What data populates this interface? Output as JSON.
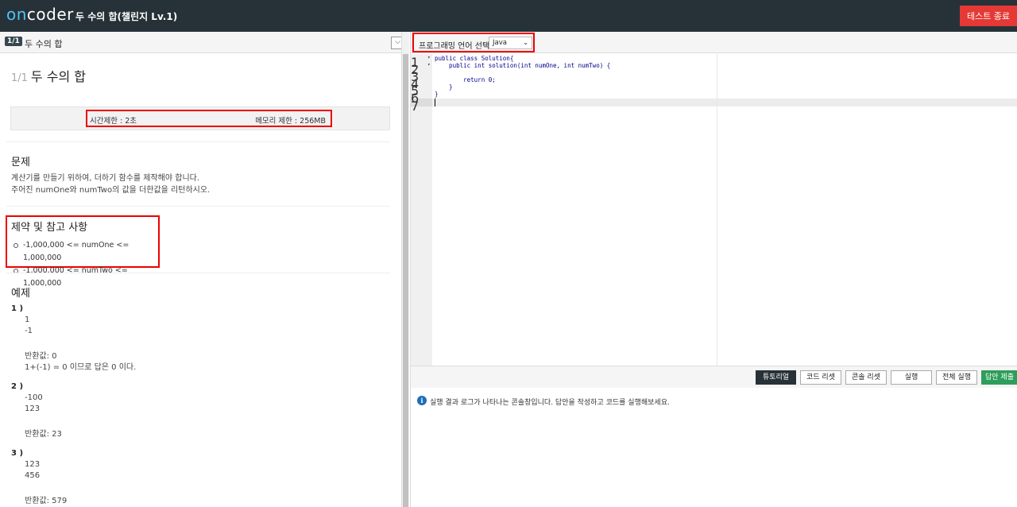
{
  "header": {
    "logo_on": "on",
    "logo_coder": "coder",
    "title": "두 수의 합(챌린지 Lv.1)",
    "end_test_label": "테스트 종료"
  },
  "left_panel": {
    "badge": "1/1",
    "header_title": "두 수의 합",
    "collapse_icon": "chevron-down-icon",
    "problem_number": "1/1",
    "problem_title": "두 수의 합",
    "time_limit": "시간제한 : 2초",
    "memory_limit": "메모리 제한 : 256MB",
    "problem_heading": "문제",
    "problem_lines": [
      "계산기를 만들기 위하여, 더하기 함수를 제작해야 합니다.",
      "주어진 numOne와 numTwo의 값을 더한값을 리턴하시오."
    ],
    "constraints_heading": "제약 및 참고 사항",
    "constraints": [
      "-1,000,000 <= numOne <= 1,000,000",
      "-1,000,000 <= numTwo <= 1,000,000"
    ],
    "examples_heading": "예제",
    "examples": [
      {
        "num": "1 )",
        "lines": [
          "1",
          "-1",
          "",
          "반환값: 0",
          "1+(-1) = 0 이므로 답은 0 이다."
        ]
      },
      {
        "num": "2 )",
        "lines": [
          "-100",
          "123",
          "",
          "반환값: 23"
        ]
      },
      {
        "num": "3 )",
        "lines": [
          "123",
          "456",
          "",
          "반환값: 579"
        ]
      }
    ]
  },
  "right_panel": {
    "lang_label": "프로그래밍 언어 선택",
    "lang_selected": "Java",
    "code_lines": [
      "public class Solution{",
      "    public int solution(int numOne, int numTwo) {",
      "",
      "        return 0;",
      "    }",
      "}",
      ""
    ],
    "line_numbers": [
      "1",
      "2",
      "3",
      "4",
      "5",
      "6",
      "7"
    ],
    "buttons": {
      "tutorial": "튜토리얼",
      "code_reset": "코드 리셋",
      "console_reset": "콘솔 리셋",
      "run": "실행",
      "run_all": "전체 실행",
      "submit": "답안 제출"
    },
    "console_message": "실행 결과 로그가 나타나는 콘솔창입니다. 답안을 작성하고 코드를 실행해보세요."
  }
}
